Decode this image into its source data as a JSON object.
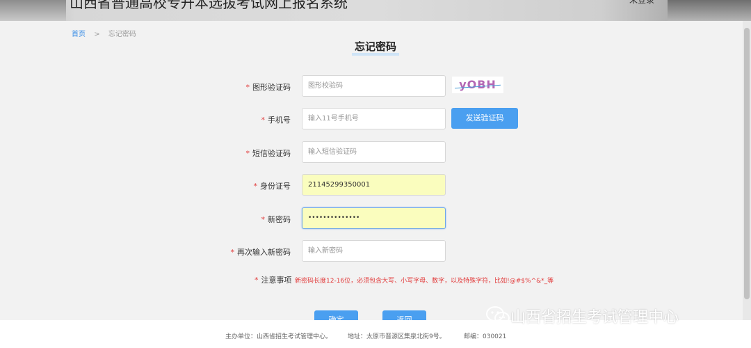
{
  "header": {
    "title": "山西省普通高校专升本选拔考试网上报名系统",
    "login": "未登录"
  },
  "breadcrumb": {
    "home": "首页",
    "sep": ">",
    "current": "忘记密码"
  },
  "page": {
    "title": "忘记密码"
  },
  "form": {
    "required_mark": "*",
    "captcha": {
      "label": "图形验证码",
      "placeholder": "图形校验码",
      "image_text": "yOBH"
    },
    "phone": {
      "label": "手机号",
      "placeholder": "输入11号手机号",
      "send_button": "发送验证码"
    },
    "sms": {
      "label": "短信验证码",
      "placeholder": "输入短信验证码"
    },
    "id_number": {
      "label": "身份证号",
      "value": "21145299350001"
    },
    "new_password": {
      "label": "新密码",
      "value": "••••••••••••••"
    },
    "confirm_password": {
      "label": "再次输入新密码",
      "placeholder": "输入新密码"
    },
    "note": {
      "label": "注意事项",
      "text": "新密码长度12-16位，必须包含大写、小写字母、数字，以及特殊字符，比如!@#$%^&*_等"
    },
    "buttons": {
      "submit": "确定",
      "back": "返回"
    }
  },
  "footer": {
    "sponsor": "主办单位：山西省招生考试管理中心。",
    "address": "地址：太原市晋源区集泉北街9号。",
    "postcode": "邮编：030021"
  },
  "watermark": {
    "text": "山西省招生考试管理中心",
    "icon": "wechat-icon"
  },
  "colors": {
    "accent": "#4a9ff0",
    "required": "#e23c3c",
    "autofill": "#fafdbe",
    "link": "#3a8ee6"
  }
}
